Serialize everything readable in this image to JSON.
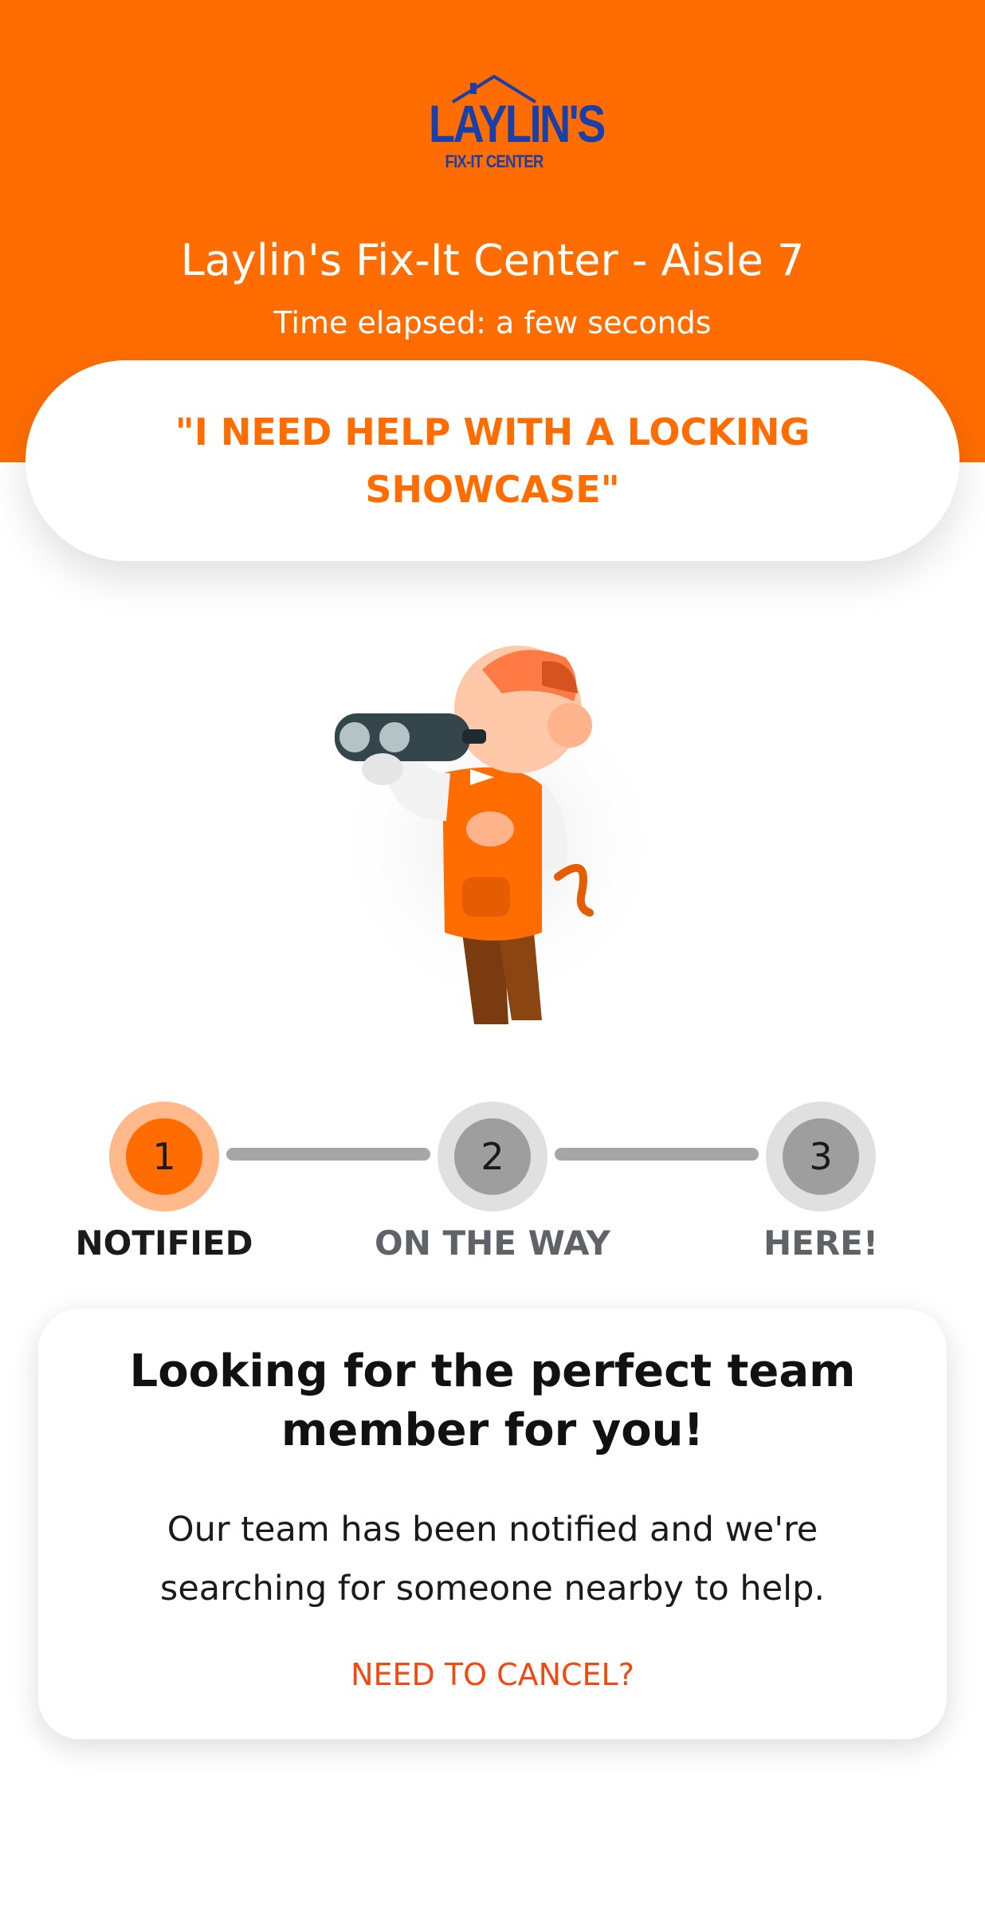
{
  "header": {
    "logo": {
      "name": "LAYLIN'S",
      "tagline": "FIX-IT CENTER"
    },
    "store_location": "Laylin's Fix-It Center - Aisle 7",
    "time_elapsed": "Time elapsed: a few seconds"
  },
  "request": {
    "text": "\"I NEED HELP WITH A LOCKING SHOWCASE\""
  },
  "illustration": {
    "icon": "binoculars-searching-mascot"
  },
  "stepper": {
    "steps": [
      {
        "number": "1",
        "label": "NOTIFIED",
        "state": "active"
      },
      {
        "number": "2",
        "label": "ON THE WAY",
        "state": "pending"
      },
      {
        "number": "3",
        "label": "HERE!",
        "state": "pending"
      }
    ]
  },
  "status_card": {
    "heading": "Looking for the perfect team member for you!",
    "body": "Our team has been notified and we're searching for someone nearby to help.",
    "cancel_label": "NEED TO CANCEL?"
  },
  "colors": {
    "brand_orange": "#ff6d00",
    "logo_blue": "#1a3fa6",
    "cancel_red": "#f04a12",
    "step_inactive": "#9e9e9e"
  }
}
